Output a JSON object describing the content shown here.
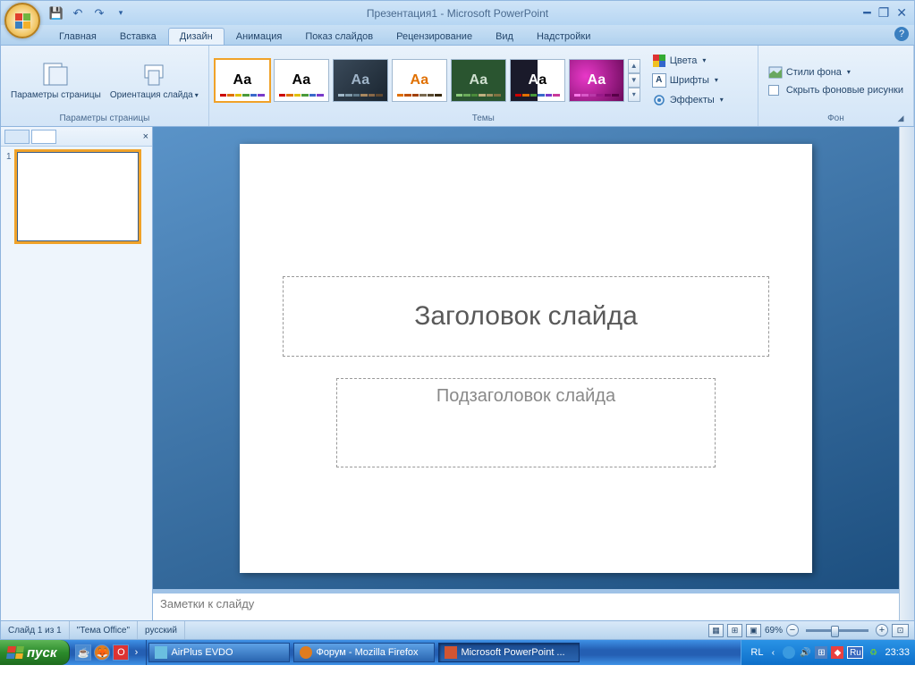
{
  "title": "Презентация1 - Microsoft PowerPoint",
  "tabs": {
    "home": "Главная",
    "insert": "Вставка",
    "design": "Дизайн",
    "animation": "Анимация",
    "slideshow": "Показ слайдов",
    "review": "Рецензирование",
    "view": "Вид",
    "addins": "Надстройки"
  },
  "ribbon": {
    "page_setup_group": "Параметры страницы",
    "page_setup": "Параметры страницы",
    "orientation": "Ориентация слайда",
    "themes_group": "Темы",
    "colors": "Цвета",
    "fonts": "Шрифты",
    "effects": "Эффекты",
    "background_group": "Фон",
    "bg_styles": "Стили фона",
    "hide_bg": "Скрыть фоновые рисунки"
  },
  "slide": {
    "title_placeholder": "Заголовок слайда",
    "subtitle_placeholder": "Подзаголовок слайда"
  },
  "notes_placeholder": "Заметки к слайду",
  "status": {
    "slide_counter": "Слайд 1 из 1",
    "theme": "\"Тема Office\"",
    "lang": "русский",
    "zoom": "69%"
  },
  "taskbar": {
    "start": "пуск",
    "airplus": "AirPlus EVDO",
    "firefox": "Форум - Mozilla Firefox",
    "powerpoint": "Microsoft PowerPoint ...",
    "lang_ind": "RL",
    "ru": "Ru",
    "clock": "23:33"
  },
  "thumb_number": "1"
}
